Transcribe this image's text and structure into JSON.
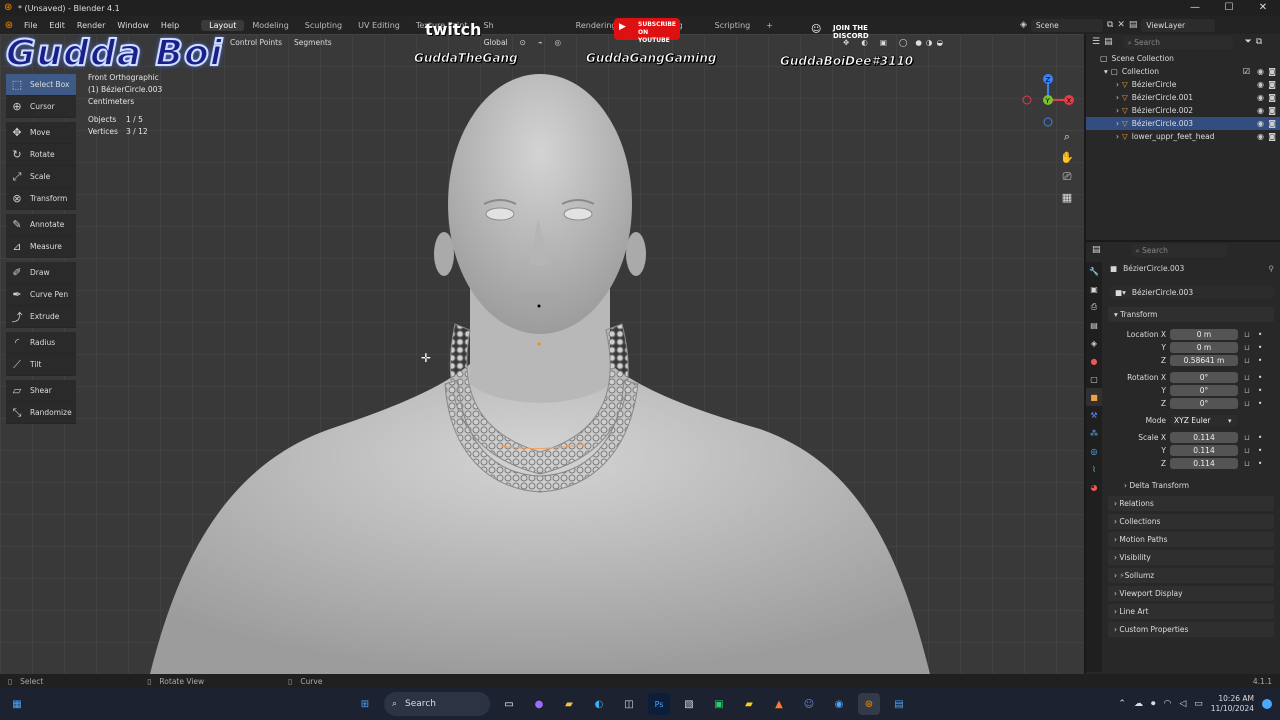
{
  "window": {
    "title": "* (Unsaved) - Blender 4.1",
    "minimize": "—",
    "maximize": "☐",
    "close": "✕"
  },
  "menu": [
    "File",
    "Edit",
    "Render",
    "Window",
    "Help"
  ],
  "workspaces": [
    "Layout",
    "Modeling",
    "Sculpting",
    "UV Editing",
    "Texture Paint",
    "Sh",
    "Rendering",
    "Compositing",
    "Scripting",
    "+"
  ],
  "scene": {
    "scene": "Scene",
    "view_layer": "ViewLayer"
  },
  "viewport_header": {
    "control_points": "Control Points",
    "segments": "Segments",
    "orientation": "Global"
  },
  "overlay": {
    "logo": "Gudda Boi",
    "twitch_logo": "twitch",
    "twitch_name": "GuddaTheGang",
    "youtube_line1": "SUBSCRIBE",
    "youtube_line2": "ON YOUTUBE",
    "youtube_name": "GuddaGangGaming",
    "discord_line1": "JOIN THE",
    "discord_line2": "DISCORD",
    "discord_name": "GuddaBoiDee#3110"
  },
  "tools": [
    {
      "label": "Select Box",
      "icon": "select-box-icon"
    },
    {
      "label": "Cursor",
      "icon": "cursor-icon"
    },
    {
      "label": "Move",
      "icon": "move-icon"
    },
    {
      "label": "Rotate",
      "icon": "rotate-icon"
    },
    {
      "label": "Scale",
      "icon": "scale-icon"
    },
    {
      "label": "Transform",
      "icon": "transform-icon"
    },
    {
      "label": "Annotate",
      "icon": "annotate-icon"
    },
    {
      "label": "Measure",
      "icon": "measure-icon"
    },
    {
      "label": "Draw",
      "icon": "draw-icon"
    },
    {
      "label": "Curve Pen",
      "icon": "curve-pen-icon"
    },
    {
      "label": "Extrude",
      "icon": "extrude-icon"
    },
    {
      "label": "Radius",
      "icon": "radius-icon"
    },
    {
      "label": "Tilt",
      "icon": "tilt-icon"
    },
    {
      "label": "Shear",
      "icon": "shear-icon"
    },
    {
      "label": "Randomize",
      "icon": "randomize-icon"
    }
  ],
  "viewport_info": {
    "view": "Front Orthographic",
    "object": "(1) BézierCircle.003",
    "units": "Centimeters",
    "objects_label": "Objects",
    "objects_value": "1 / 5",
    "vertices_label": "Vertices",
    "vertices_value": "3 / 12"
  },
  "gizmo": {
    "z": "Z",
    "y": "Y",
    "x": "X"
  },
  "outliner": {
    "search_placeholder": "Search",
    "scene_collection": "Scene Collection",
    "collection": "Collection",
    "items": [
      "BézierCircle",
      "BézierCircle.001",
      "BézierCircle.002",
      "BézierCircle.003",
      "lower_uppr_feet_head"
    ],
    "selected_index": 3
  },
  "properties": {
    "search_placeholder": "Search",
    "object_name": "BézierCircle.003",
    "data_name": "BézierCircle.003",
    "transform_header": "Transform",
    "location_label": "Location X",
    "location": [
      "0 m",
      "0 m",
      "0.58641 m"
    ],
    "rotation_label": "Rotation X",
    "rotation": [
      "0°",
      "0°",
      "0°"
    ],
    "mode_label": "Mode",
    "mode": "XYZ Euler",
    "scale_label": "Scale X",
    "scale": [
      "0.114",
      "0.114",
      "0.114"
    ],
    "axis_y": "Y",
    "axis_z": "Z",
    "panels": [
      "Delta Transform",
      "Relations",
      "Collections",
      "Motion Paths",
      "Visibility",
      "Sollumz",
      "Viewport Display",
      "Line Art",
      "Custom Properties"
    ]
  },
  "statusbar": {
    "select": "Select",
    "rotate": "Rotate View",
    "curve": "Curve",
    "version": "4.1.1"
  },
  "taskbar": {
    "search": "Search",
    "time": "10:26 AM",
    "date": "11/10/2024"
  }
}
